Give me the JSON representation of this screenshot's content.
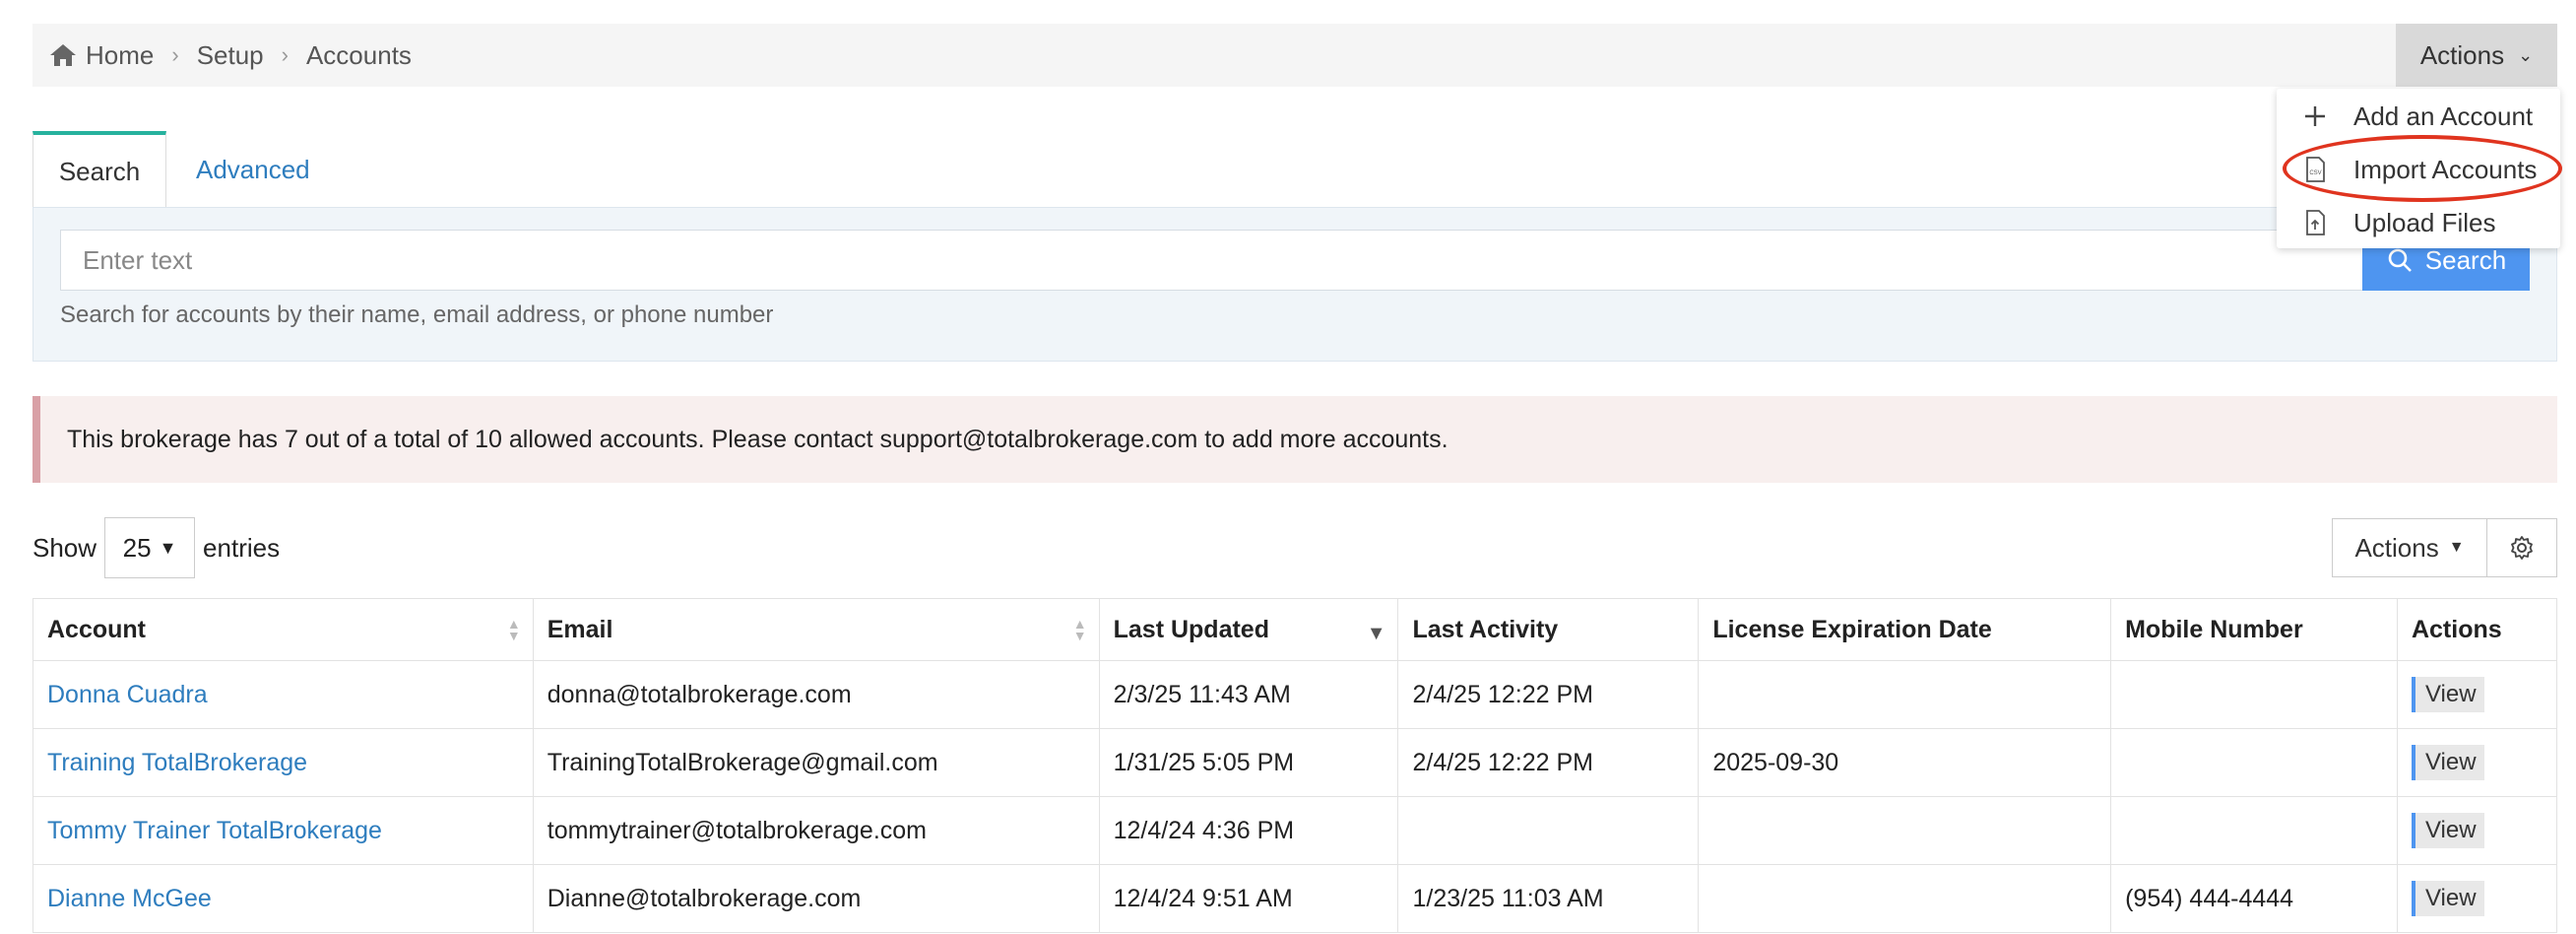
{
  "breadcrumb": {
    "items": [
      "Home",
      "Setup",
      "Accounts"
    ]
  },
  "header": {
    "actions_label": "Actions"
  },
  "actions_menu": {
    "items": [
      {
        "label": "Add an Account",
        "icon": "plus-icon"
      },
      {
        "label": "Import Accounts",
        "icon": "csv-file-icon"
      },
      {
        "label": "Upload Files",
        "icon": "upload-file-icon"
      }
    ]
  },
  "tabs": [
    {
      "label": "Search",
      "active": true
    },
    {
      "label": "Advanced",
      "active": false
    }
  ],
  "search": {
    "placeholder": "Enter text",
    "button_label": "Search",
    "help_text": "Search for accounts by their name, email address, or phone number"
  },
  "alert": {
    "text": "This brokerage has 7 out of a total of 10 allowed accounts. Please contact support@totalbrokerage.com to add more accounts."
  },
  "entries": {
    "show_label": "Show",
    "value": "25",
    "suffix": "entries"
  },
  "table_toolbar": {
    "actions_label": "Actions"
  },
  "table": {
    "columns": [
      "Account",
      "Email",
      "Last Updated",
      "Last Activity",
      "License Expiration Date",
      "Mobile Number",
      "Actions"
    ],
    "rows": [
      {
        "account": "Donna Cuadra",
        "email": "donna@totalbrokerage.com",
        "last_updated": "2/3/25 11:43 AM",
        "last_activity": "2/4/25 12:22 PM",
        "license_exp": "",
        "mobile": "",
        "action": "View"
      },
      {
        "account": "Training TotalBrokerage",
        "email": "TrainingTotalBrokerage@gmail.com",
        "last_updated": "1/31/25 5:05 PM",
        "last_activity": "2/4/25 12:22 PM",
        "license_exp": "2025-09-30",
        "mobile": "",
        "action": "View"
      },
      {
        "account": "Tommy Trainer TotalBrokerage",
        "email": "tommytrainer@totalbrokerage.com",
        "last_updated": "12/4/24 4:36 PM",
        "last_activity": "",
        "license_exp": "",
        "mobile": "",
        "action": "View"
      },
      {
        "account": "Dianne McGee",
        "email": "Dianne@totalbrokerage.com",
        "last_updated": "12/4/24 9:51 AM",
        "last_activity": "1/23/25 11:03 AM",
        "license_exp": "",
        "mobile": "(954) 444-4444",
        "action": "View"
      }
    ]
  },
  "colors": {
    "accent": "#26b29e",
    "link": "#2e7dbe",
    "primary_button": "#4e95f0",
    "highlight": "#e0341f"
  }
}
